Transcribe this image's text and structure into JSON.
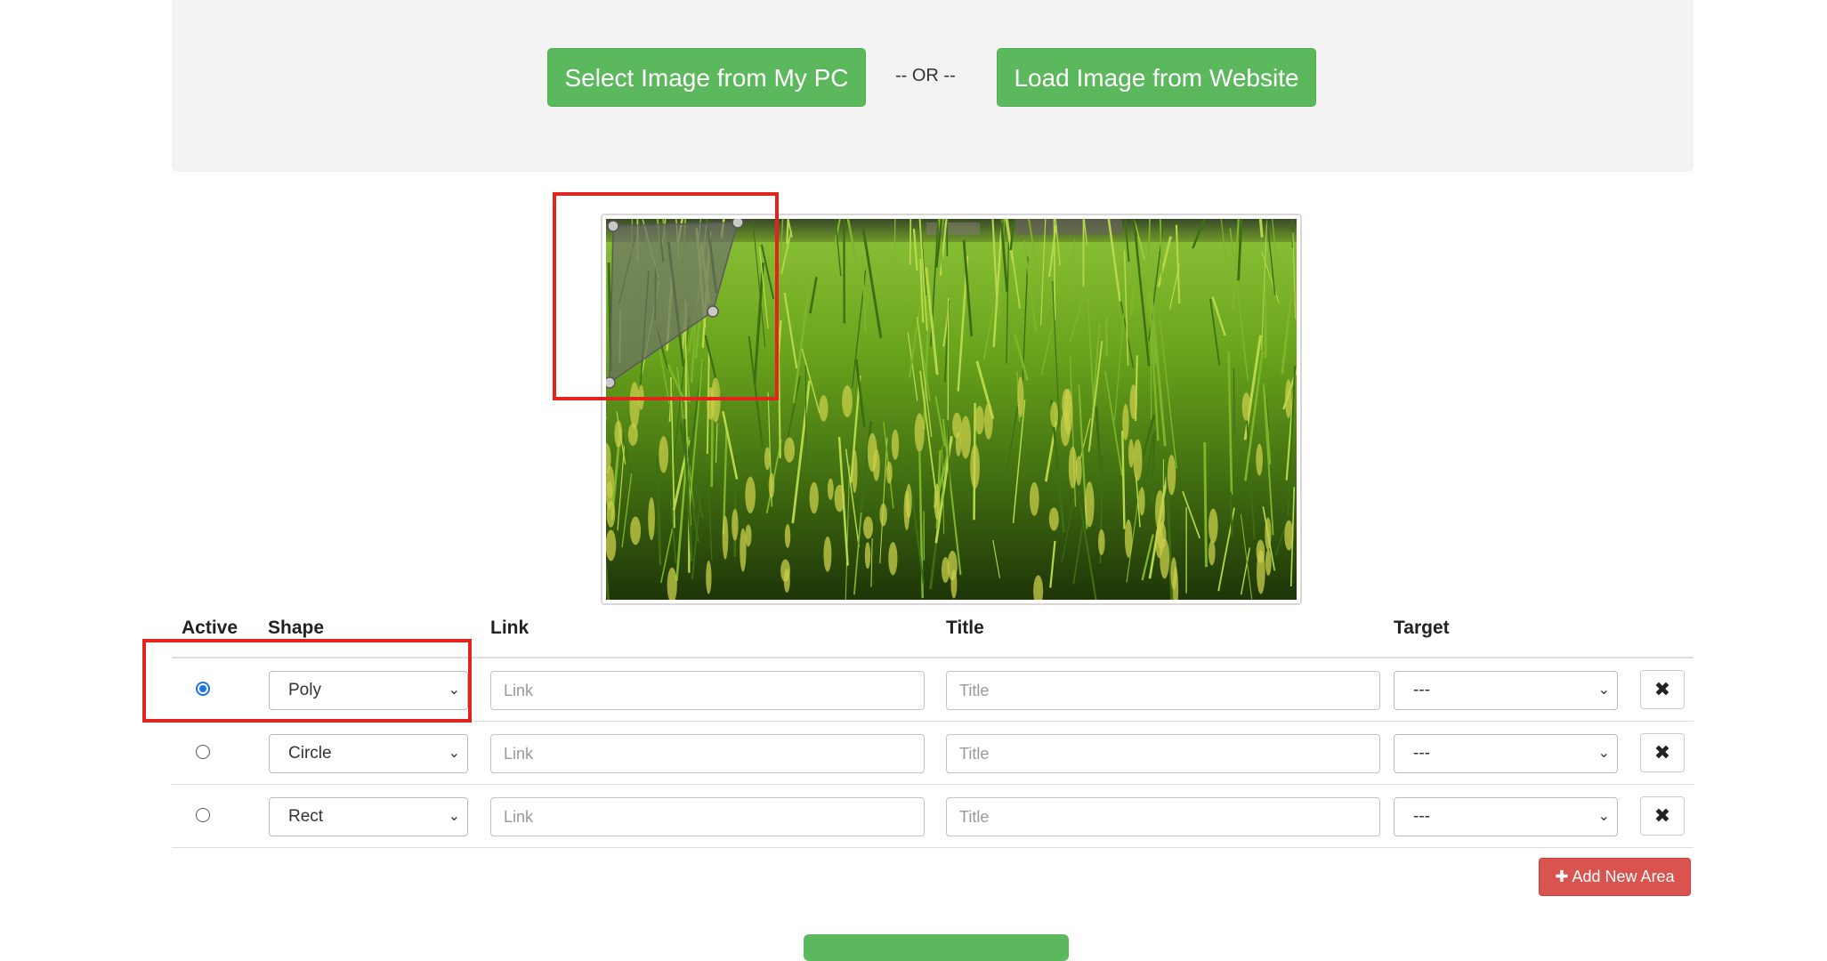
{
  "upload": {
    "select_pc_label": "Select Image from My PC",
    "separator": "-- OR --",
    "load_web_label": "Load Image from Website"
  },
  "table": {
    "headers": {
      "active": "Active",
      "shape": "Shape",
      "link": "Link",
      "title": "Title",
      "target": "Target"
    },
    "rows": [
      {
        "active": true,
        "shape": "Poly",
        "link_placeholder": "Link",
        "title_placeholder": "Title",
        "target": "---",
        "delete_icon": "✖"
      },
      {
        "active": false,
        "shape": "Circle",
        "link_placeholder": "Link",
        "title_placeholder": "Title",
        "target": "---",
        "delete_icon": "✖"
      },
      {
        "active": false,
        "shape": "Rect",
        "link_placeholder": "Link",
        "title_placeholder": "Title",
        "target": "---",
        "delete_icon": "✖"
      }
    ]
  },
  "add_area_label": "✚ Add New Area",
  "colors": {
    "primary_green": "#5cb85c",
    "danger_red": "#d9534f",
    "highlight_red": "#e3241c",
    "radio_blue": "#1a73e8"
  }
}
